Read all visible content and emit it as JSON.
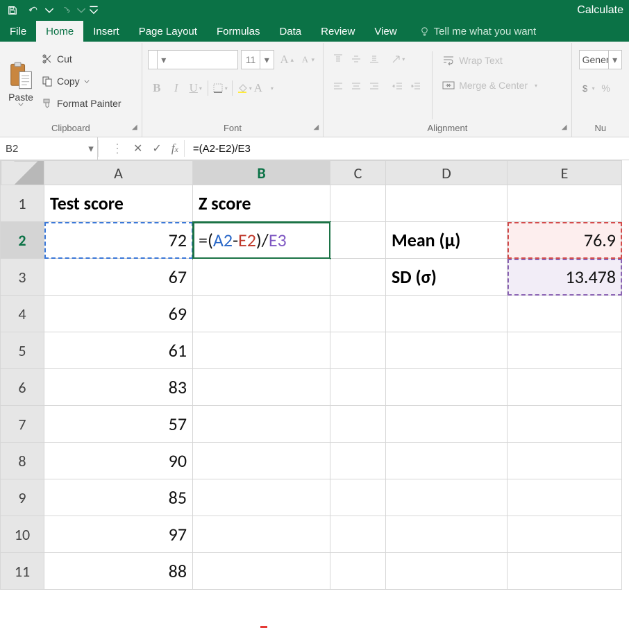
{
  "titlebar": {
    "right_text": "Calculate"
  },
  "tabs": {
    "file": "File",
    "home": "Home",
    "insert": "Insert",
    "page_layout": "Page Layout",
    "formulas": "Formulas",
    "data": "Data",
    "review": "Review",
    "view": "View",
    "tellme": "Tell me what you want",
    "active": "home"
  },
  "ribbon": {
    "clipboard": {
      "paste": "Paste",
      "cut": "Cut",
      "copy": "Copy",
      "format_painter": "Format Painter",
      "label": "Clipboard"
    },
    "font": {
      "name": "",
      "size": "11",
      "label": "Font"
    },
    "alignment": {
      "wrap_text": "Wrap Text",
      "merge_center": "Merge & Center",
      "label": "Alignment"
    },
    "number": {
      "format": "General",
      "label": "Nu"
    }
  },
  "formula_bar": {
    "name_box": "B2",
    "formula": "=(A2-E2)/E3"
  },
  "chart_data": {
    "type": "table",
    "columns": [
      "A",
      "B",
      "C",
      "D",
      "E"
    ],
    "headers": {
      "A": "Test score",
      "B": "Z score"
    },
    "rows": [
      {
        "row": 2,
        "A": 72,
        "B": "=(A2-E2)/E3",
        "D": "Mean (μ)",
        "E": 76.9
      },
      {
        "row": 3,
        "A": 67,
        "D": "SD (σ)",
        "E": 13.478
      },
      {
        "row": 4,
        "A": 69
      },
      {
        "row": 5,
        "A": 61
      },
      {
        "row": 6,
        "A": 83
      },
      {
        "row": 7,
        "A": 57
      },
      {
        "row": 8,
        "A": 90
      },
      {
        "row": 9,
        "A": 85
      },
      {
        "row": 10,
        "A": 97
      },
      {
        "row": 11,
        "A": 88
      }
    ],
    "active_cell": "B2",
    "refs": {
      "blue": "A2",
      "red": "E2",
      "purple": "E3"
    }
  },
  "gridtext": {
    "hdrA": "A",
    "hdrB": "B",
    "hdrC": "C",
    "hdrD": "D",
    "hdrE": "E",
    "r1": "1",
    "r2": "2",
    "r3": "3",
    "r4": "4",
    "r5": "5",
    "r6": "6",
    "r7": "7",
    "r8": "8",
    "r9": "9",
    "r10": "10",
    "r11": "11",
    "A1": "Test score",
    "B1": "Z score",
    "A2": "72",
    "A3": "67",
    "A4": "69",
    "A5": "61",
    "A6": "83",
    "A7": "57",
    "A8": "90",
    "A9": "85",
    "A10": "97",
    "A11": "88",
    "D2": "Mean (μ)",
    "D3": "SD (σ)",
    "E2": "76.9",
    "E3": "13.478",
    "B2_eq": "=(",
    "B2_a": "A2",
    "B2_dash": "-",
    "B2_e2": "E2",
    "B2_close": ")/",
    "B2_e3": "E3"
  }
}
